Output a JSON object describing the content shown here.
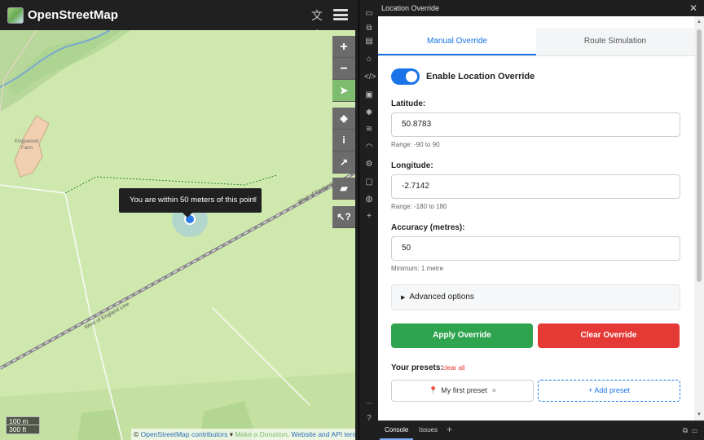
{
  "map_app": {
    "title": "OpenStreetMap",
    "icons": {
      "translate": "translate-icon",
      "menu": "hamburger-menu-icon"
    },
    "controls": [
      {
        "name": "zoom-in-button",
        "glyph": "+"
      },
      {
        "name": "zoom-out-button",
        "glyph": "−"
      },
      {
        "name": "locate-button",
        "glyph": "➤",
        "active": true
      },
      {
        "name": "layers-button",
        "glyph": "◈"
      },
      {
        "name": "map-key-button",
        "glyph": "i"
      },
      {
        "name": "share-button",
        "glyph": "↗"
      },
      {
        "name": "add-note-button",
        "glyph": "▰"
      },
      {
        "name": "query-features-button",
        "glyph": "↖?"
      }
    ],
    "map_labels": {
      "farm_1": "Kingswood",
      "farm_2": "Farm",
      "railway_1": "West of England Line",
      "railway_2": "West of England Line"
    },
    "popup": {
      "text": "You are within 50 meters of this point",
      "close": "×"
    },
    "scale": {
      "metric": "100 m",
      "imperial": "300 ft"
    },
    "attribution": {
      "copyright": "© ",
      "contributors_link": "OpenStreetMap contributors",
      "arrow": " ▾ ",
      "donation": "Make a Donation",
      "sep": ". ",
      "api_link": "Website and API terms"
    },
    "colors": {
      "land": "#cfe8ad",
      "wood": "#b7d89a",
      "farmyard": "#f0d0b0",
      "accent": "#7ebc6f"
    }
  },
  "devtools": {
    "panel_title": "Location Override",
    "close": "✕",
    "drawer": {
      "console": "Console",
      "issues": "Issues",
      "add": "+"
    }
  },
  "extension": {
    "tabs": [
      {
        "label": "Manual Override",
        "active": true
      },
      {
        "label": "Route Simulation",
        "active": false
      }
    ],
    "toggle": {
      "label": "Enable Location Override",
      "on": true
    },
    "latitude": {
      "label": "Latitude:",
      "value": "50.8783",
      "hint": "Range: -90 to 90"
    },
    "longitude": {
      "label": "Longitude:",
      "value": "-2.7142",
      "hint": "Range: -180 to 180"
    },
    "accuracy": {
      "label": "Accuracy (metres):",
      "value": "50",
      "hint": "Minimum: 1 metre"
    },
    "advanced": {
      "arrow": "▶",
      "label": "Advanced options"
    },
    "apply_label": "Apply Override",
    "clear_label": "Clear Override",
    "presets": {
      "label": "Your presets:",
      "clear_all": "clear all",
      "items": [
        {
          "pin": "📍",
          "label": "My first preset",
          "remove": "×"
        }
      ],
      "add_label": "+ Add preset"
    },
    "colors": {
      "primary": "#1a73e8",
      "apply": "#2ea44f",
      "clear": "#e53935"
    }
  }
}
